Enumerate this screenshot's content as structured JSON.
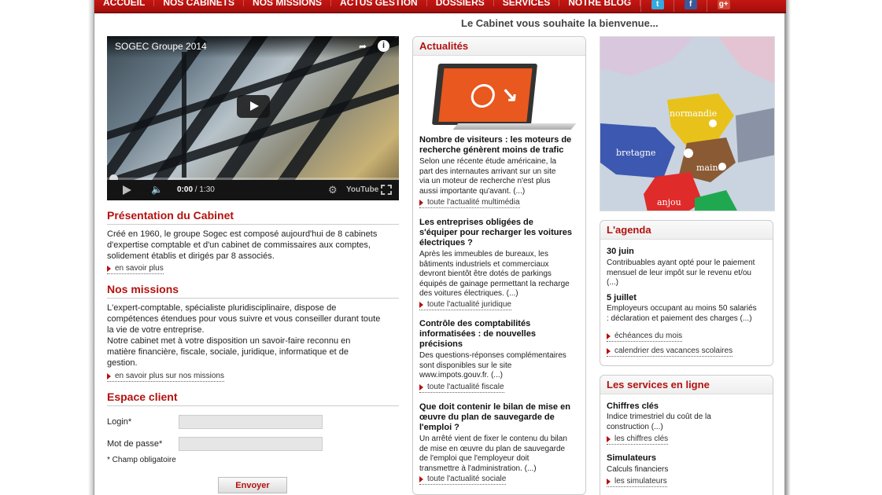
{
  "nav": {
    "items": [
      "ACCUEIL",
      "NOS CABINETS",
      "NOS MISSIONS",
      "ACTUS GESTION",
      "DOSSIERS",
      "SERVICES",
      "NOTRE BLOG"
    ],
    "social": [
      "twitter-icon",
      "facebook-icon",
      "google-plus-icon"
    ]
  },
  "welcome": "Le Cabinet vous souhaite la bienvenue...",
  "video": {
    "title": "SOGEC Groupe 2014",
    "time_current": "0:00",
    "time_total": "/ 1:30",
    "brand": "YouTube"
  },
  "presentation": {
    "title": "Présentation du Cabinet",
    "text_lines": [
      "Créé en 1960, le groupe Sogec est composé aujourd'hui de 8 cabinets",
      "d'expertise comptable et d'un cabinet de commissaires aux comptes,",
      "solidement établis et dirigés par 8 associés."
    ],
    "link": "en savoir plus"
  },
  "missions": {
    "title": "Nos missions",
    "text_lines": [
      "L'expert-comptable, spécialiste pluridisciplinaire, dispose de",
      "compétences étendues pour vous suivre et vous conseiller durant toute",
      "la vie de votre entreprise.",
      "Notre cabinet met à votre disposition un savoir-faire reconnu en",
      "matière financière, fiscale, sociale, juridique, informatique et de",
      "gestion."
    ],
    "link": "en savoir plus sur nos missions"
  },
  "client": {
    "title": "Espace client",
    "login_label": "Login*",
    "password_label": "Mot de passe*",
    "required_note": "* Champ obligatoire",
    "submit": "Envoyer",
    "login_value": "",
    "password_value": ""
  },
  "news": {
    "title": "Actualités",
    "items": [
      {
        "title_lines": [
          "Nombre de visiteurs : les moteurs de",
          "recherche génèrent moins de trafic"
        ],
        "text_lines": [
          "Selon une récente étude américaine, la",
          "part des internautes arrivant sur un site",
          "via un moteur de recherche n'est plus",
          "aussi importante qu'avant. (...)"
        ],
        "link": "toute l'actualité multimédia"
      },
      {
        "title_lines": [
          "Les entreprises obligées de",
          "s'équiper pour recharger les voitures",
          "électriques ?"
        ],
        "text_lines": [
          "Après les immeubles de bureaux, les",
          "bâtiments industriels et commerciaux",
          "devront bientôt être dotés de parkings",
          "équipés de gainage permettant la recharge",
          "des voitures électriques. (...)"
        ],
        "link": "toute l'actualité juridique"
      },
      {
        "title_lines": [
          "Contrôle des comptabilités",
          "informatisées : de nouvelles",
          "précisions"
        ],
        "text_lines": [
          "Des questions-réponses complémentaires",
          "sont disponibles sur le site",
          "www.impots.gouv.fr. (...)"
        ],
        "link": "toute l'actualité fiscale"
      },
      {
        "title_lines": [
          "Que doit contenir le bilan de mise en",
          "œuvre du plan de sauvegarde de",
          "l'emploi ?"
        ],
        "text_lines": [
          "Un arrêté vient de fixer le contenu du bilan",
          "de mise en œuvre du plan de sauvegarde",
          "de l'emploi que l'employeur doit",
          "transmettre à l'administration. (...)"
        ],
        "link": "toute l'actualité sociale"
      }
    ]
  },
  "map": {
    "regions": [
      "normandie",
      "bretagne",
      "maine",
      "anjou"
    ]
  },
  "agenda": {
    "title": "L'agenda",
    "events": [
      {
        "date": "30 juin",
        "text_lines": [
          "Contribuables ayant opté pour le paiement",
          "mensuel de leur impôt sur le revenu et/ou",
          "(...)"
        ]
      },
      {
        "date": "5 juillet",
        "text_lines": [
          "Employeurs occupant au moins 50 salariés",
          " :  déclaration et paiement des charges (...)"
        ]
      }
    ],
    "links": [
      "échéances du mois",
      "calendrier des vacances scolaires"
    ]
  },
  "services": {
    "title": "Les services en ligne",
    "items": [
      {
        "title": "Chiffres clés",
        "text_lines": [
          "Indice trimestriel du coût de la",
          "construction (...)"
        ],
        "link": "les chiffres clés"
      },
      {
        "title": "Simulateurs",
        "text_lines": [
          "Calculs financiers"
        ],
        "link": "les simulateurs"
      }
    ]
  }
}
